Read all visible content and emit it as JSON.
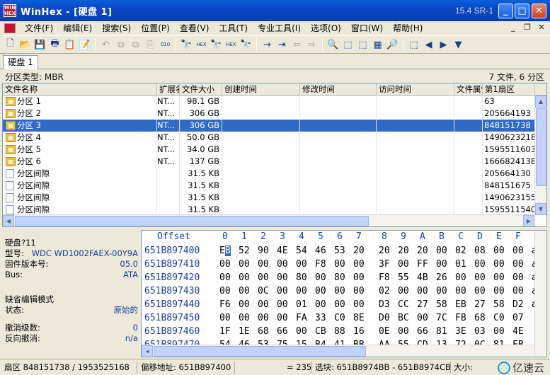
{
  "window": {
    "icon_text": "WIN HEX",
    "title": "WinHex - [硬盘 1]",
    "version": "15.4 SR-1",
    "min_glyph": "_",
    "max_glyph": "□",
    "close_glyph": "✕"
  },
  "menu": [
    "文件(F)",
    "编辑(E)",
    "搜索(S)",
    "位置(P)",
    "查看(V)",
    "工具(T)",
    "专业工具(I)",
    "选项(O)",
    "窗口(W)",
    "帮助(H)"
  ],
  "mdi": [
    "_",
    "❐",
    "✕"
  ],
  "toolbar": [
    "🗋",
    "📂",
    "💾",
    "🖶",
    "📋",
    "📝",
    "↶",
    "⧉",
    "⧉",
    "⎘",
    "010",
    "🔭",
    "HEX",
    "🔭",
    "HEX",
    "🔭",
    "→",
    "⇥",
    "⇦",
    "⇨",
    "🔍",
    "⬚",
    "⬚",
    "▦",
    "🔎",
    "⬚",
    "◀",
    "▶",
    "▼"
  ],
  "tab": {
    "label": "硬盘 1"
  },
  "pane": {
    "left": "分区类型: MBR",
    "right": "7 文件, 6 分区"
  },
  "columns": [
    "文件名称",
    "扩展名",
    "文件大小",
    "创建时间",
    "修改时间",
    "访问时间",
    "文件属性",
    "第1扇区"
  ],
  "rows": [
    {
      "name": "分区 1",
      "ext": "NT...",
      "size": "98.1 GB",
      "sector": "63",
      "type": "part",
      "selected": false
    },
    {
      "name": "分区 2",
      "ext": "NT...",
      "size": "306 GB",
      "sector": "205664193",
      "type": "part",
      "selected": false
    },
    {
      "name": "分区 3",
      "ext": "NT...",
      "size": "306 GB",
      "sector": "848151738",
      "type": "part",
      "selected": true
    },
    {
      "name": "分区 4",
      "ext": "NT...",
      "size": "50.0 GB",
      "sector": "1490623218",
      "type": "part",
      "selected": false
    },
    {
      "name": "分区 5",
      "ext": "NT...",
      "size": "34.0 GB",
      "sector": "1595511603",
      "type": "part",
      "selected": false
    },
    {
      "name": "分区 6",
      "ext": "NT...",
      "size": "137 GB",
      "sector": "1666824138",
      "type": "part",
      "selected": false
    },
    {
      "name": "分区间隙",
      "ext": "",
      "size": "31.5 KB",
      "sector": "205664130",
      "type": "gap",
      "selected": false
    },
    {
      "name": "分区间隙",
      "ext": "",
      "size": "31.5 KB",
      "sector": "848151675",
      "type": "gap",
      "selected": false
    },
    {
      "name": "分区间隙",
      "ext": "",
      "size": "31.5 KB",
      "sector": "1490623155",
      "type": "gap",
      "selected": false
    },
    {
      "name": "分区间隙",
      "ext": "",
      "size": "31.5 KB",
      "sector": "1595511540",
      "type": "gap",
      "selected": false
    }
  ],
  "info": {
    "disk": "硬盘?11",
    "model_label": "型号:",
    "model_value": "WDC WD1002FAEX-00Y9A",
    "firmware_label": "固件版本号:",
    "firmware_value": "05.0",
    "bus_label": "Bus:",
    "bus_value": "ATA",
    "mode_label": "缺省编辑模式",
    "state_label": "状态:",
    "state_value": "原始的",
    "undo_label": "撤消级数:",
    "undo_value": "0",
    "redo_label": "反向撤消:",
    "redo_value": "n/a"
  },
  "hex": {
    "header_label": "Offset",
    "header_cols": [
      "0",
      "1",
      "2",
      "3",
      "4",
      "5",
      "6",
      "7",
      "8",
      "9",
      "A",
      "B",
      "C",
      "D",
      "E",
      "F"
    ],
    "rows": [
      {
        "offset": "651B897400",
        "bytes": [
          "EB",
          "52",
          "90",
          "4E",
          "54",
          "46",
          "53",
          "20",
          "20",
          "20",
          "20",
          "00",
          "02",
          "08",
          "00",
          "00"
        ]
      },
      {
        "offset": "651B897410",
        "bytes": [
          "00",
          "00",
          "00",
          "00",
          "00",
          "F8",
          "00",
          "00",
          "3F",
          "00",
          "FF",
          "00",
          "01",
          "00",
          "00",
          "00"
        ]
      },
      {
        "offset": "651B897420",
        "bytes": [
          "00",
          "00",
          "00",
          "00",
          "80",
          "00",
          "80",
          "00",
          "F8",
          "55",
          "4B",
          "26",
          "00",
          "00",
          "00",
          "00"
        ]
      },
      {
        "offset": "651B897430",
        "bytes": [
          "00",
          "00",
          "0C",
          "00",
          "00",
          "00",
          "00",
          "00",
          "02",
          "00",
          "00",
          "00",
          "00",
          "00",
          "00",
          "00"
        ]
      },
      {
        "offset": "651B897440",
        "bytes": [
          "F6",
          "00",
          "00",
          "00",
          "01",
          "00",
          "00",
          "00",
          "D3",
          "CC",
          "27",
          "58",
          "EB",
          "27",
          "58",
          "D2"
        ]
      },
      {
        "offset": "651B897450",
        "bytes": [
          "00",
          "00",
          "00",
          "00",
          "FA",
          "33",
          "C0",
          "8E",
          "D0",
          "BC",
          "00",
          "7C",
          "FB",
          "68",
          "C0",
          "07"
        ]
      },
      {
        "offset": "651B897460",
        "bytes": [
          "1F",
          "1E",
          "68",
          "66",
          "00",
          "CB",
          "88",
          "16",
          "0E",
          "00",
          "66",
          "81",
          "3E",
          "03",
          "00",
          "4E"
        ]
      },
      {
        "offset": "651B897470",
        "bytes": [
          "54",
          "46",
          "53",
          "75",
          "15",
          "B4",
          "41",
          "BB",
          "AA",
          "55",
          "CD",
          "13",
          "72",
          "0C",
          "81",
          "FB"
        ]
      }
    ],
    "trailing": "a"
  },
  "status": {
    "sector": "扇区 848151738 / 1953525168",
    "offset": "偏移地址:  651B897400",
    "value": "= 235",
    "block": "选块: 651B8974BB - 651B8974CB",
    "size": "大小:",
    "watermark": "亿速云"
  }
}
